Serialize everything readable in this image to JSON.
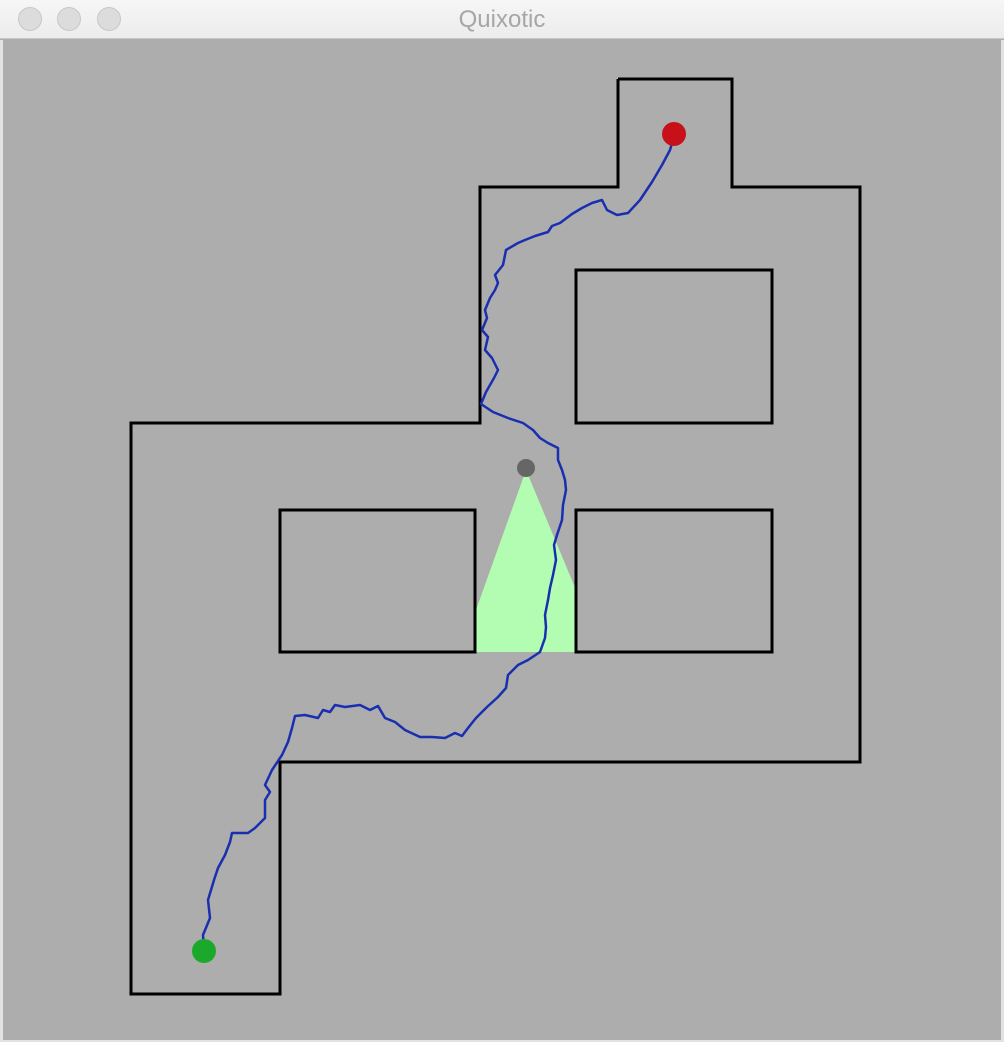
{
  "window": {
    "title": "Quixotic"
  },
  "colors": {
    "background": "#adadad",
    "walls": "#000000",
    "path": "#1a2fb0",
    "goal": "#c8101a",
    "start": "#1aa92a",
    "robot": "#666666",
    "sensor_cone": "#b2fdb2"
  },
  "icons": [
    "close-button",
    "minimize-button",
    "maximize-button",
    "goal-marker",
    "start-marker",
    "robot-marker"
  ]
}
